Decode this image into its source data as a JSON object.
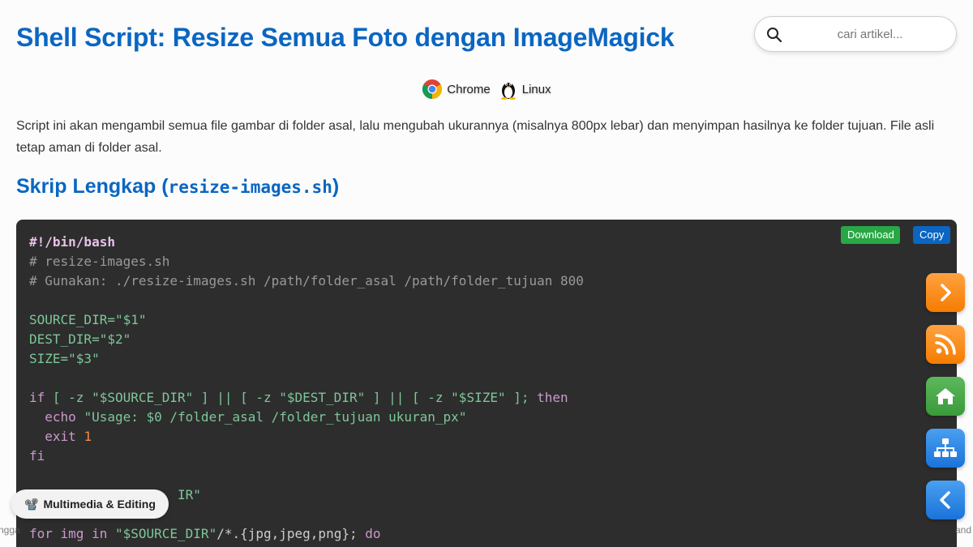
{
  "page": {
    "title": "Shell Script: Resize Semua Foto dengan ImageMagick"
  },
  "search": {
    "placeholder": "cari artikel..."
  },
  "platforms": [
    {
      "label": "Chrome",
      "icon": "chrome-icon"
    },
    {
      "label": "Linux",
      "icon": "linux-tux-icon"
    }
  ],
  "intro": "Script ini akan mengambil semua file gambar di folder asal, lalu mengubah ukurannya (misalnya 800px lebar) dan menyimpan hasilnya ke folder tujuan. File asli tetap aman di folder asal.",
  "section": {
    "heading_prefix": "Skrip Lengkap (",
    "heading_code": "resize-images.sh",
    "heading_suffix": ")"
  },
  "code": {
    "download_label": "Download",
    "copy_label": "Copy",
    "lines": {
      "l1": "#!/bin/bash",
      "l2": "# resize-images.sh",
      "l3": "# Gunakan: ./resize-images.sh /path/folder_asal /path/folder_tujuan 800",
      "l5": "SOURCE_DIR=\"$1\"",
      "l6": "DEST_DIR=\"$2\"",
      "l7": "SIZE=\"$3\"",
      "l9a": "if",
      "l9b": " [ -z \"$SOURCE_DIR\" ] || [ -z \"$DEST_DIR\" ] || [ -z \"$SIZE\" ]; ",
      "l9c": "then",
      "l10a": "  echo ",
      "l10b": "\"Usage: $0 /folder_asal /folder_tujuan ukuran_px\"",
      "l11a": "  exit ",
      "l11b": "1",
      "l12": "fi",
      "l14": "                   IR\"",
      "l16a": "for img in ",
      "l16b": "\"$SOURCE_DIR\"",
      "l16c": "/*.{jpg,jpeg,png}; ",
      "l16d": "do"
    }
  },
  "category": {
    "emoji": "📽️",
    "label": "Multimedia & Editing"
  },
  "footer": {
    "left_text": "ngga",
    "right_text": "and"
  },
  "side_nav": [
    {
      "name": "next-article-button",
      "icon": "chevron-right-icon"
    },
    {
      "name": "rss-feed-button",
      "icon": "rss-icon"
    },
    {
      "name": "home-button",
      "icon": "home-icon"
    },
    {
      "name": "sitemap-button",
      "icon": "sitemap-icon"
    },
    {
      "name": "previous-article-button",
      "icon": "chevron-left-icon"
    }
  ],
  "colors": {
    "title_blue": "#0a66c2",
    "download_green": "#28a745",
    "copy_blue": "#0a66c2",
    "code_bg": "#2d2d2d",
    "orange": "#f57c00",
    "green": "#3a9a3a"
  }
}
